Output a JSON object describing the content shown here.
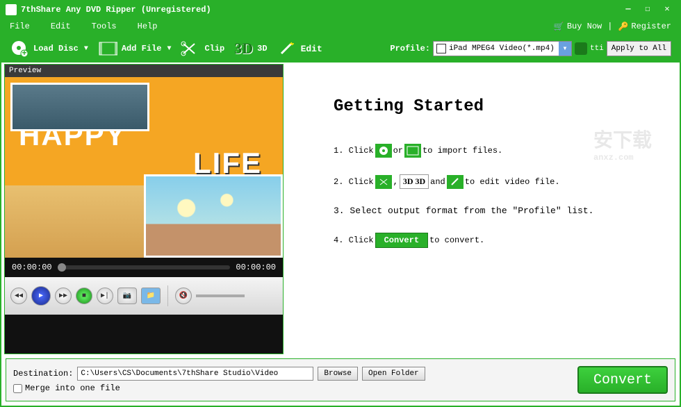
{
  "titlebar": {
    "title": "7thShare Any DVD Ripper (Unregistered)"
  },
  "menu": {
    "file": "File",
    "edit": "Edit",
    "tools": "Tools",
    "help": "Help",
    "buy_now": "Buy Now",
    "register": "Register"
  },
  "toolbar": {
    "load_disc": "Load Disc",
    "add_file": "Add File",
    "clip": "Clip",
    "three_d": "3D",
    "three_d_label": "3D",
    "edit": "Edit",
    "profile_label": "Profile:",
    "profile_value": "iPad MPEG4 Video(*.mp4)",
    "tti": "tti",
    "apply_all": "Apply to All"
  },
  "preview": {
    "header": "Preview",
    "time_start": "00:00:00",
    "time_end": "00:00:00"
  },
  "getting_started": {
    "title": "Getting Started",
    "step1_a": "1. Click ",
    "step1_b": " or ",
    "step1_c": " to import files.",
    "step2_a": "2. Click ",
    "step2_b": ", ",
    "step2_3d": "3D 3D",
    "step2_c": " and ",
    "step2_d": " to edit video file.",
    "step3": "3. Select output format from the \"Profile\" list.",
    "step4_a": "4. Click ",
    "step4_btn": "Convert",
    "step4_b": " to convert."
  },
  "bottom": {
    "destination_label": "Destination:",
    "destination_path": "C:\\Users\\CS\\Documents\\7thShare Studio\\Video",
    "browse": "Browse",
    "open_folder": "Open Folder",
    "merge": "Merge into one file",
    "convert": "Convert"
  },
  "watermark": "anxz.com"
}
